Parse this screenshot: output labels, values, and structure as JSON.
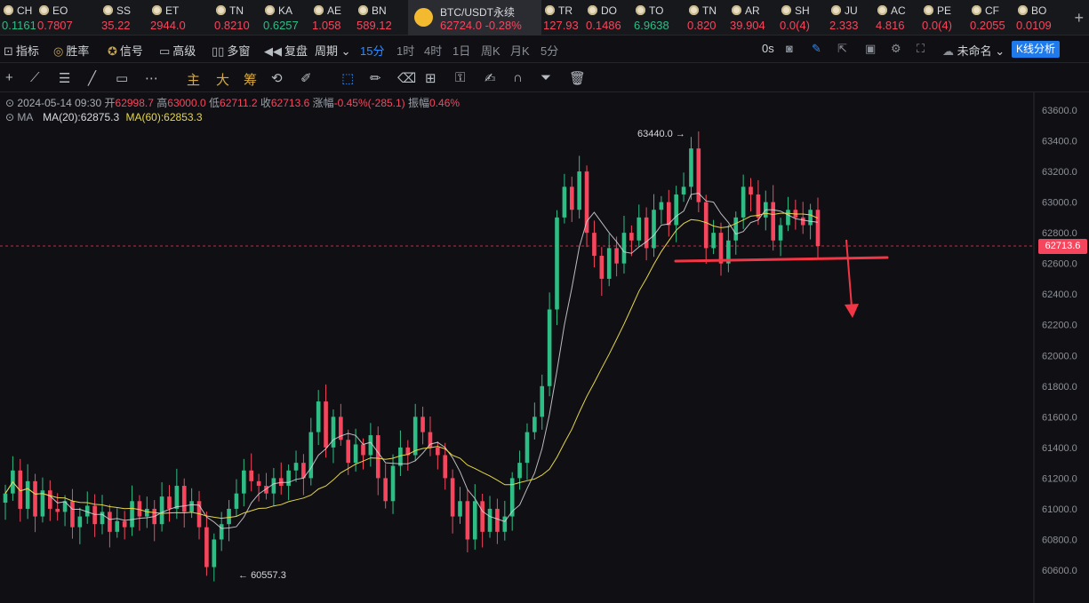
{
  "ticker": [
    {
      "sym": "CH",
      "val": "0.1161",
      "dir": "up"
    },
    {
      "sym": "EO",
      "val": "0.7807",
      "dir": "down"
    },
    {
      "sym": "SS",
      "val": "35.22",
      "dir": "down"
    },
    {
      "sym": "ET",
      "val": "2944.0",
      "dir": "down"
    },
    {
      "sym": "TN",
      "val": "0.8210",
      "dir": "down"
    },
    {
      "sym": "KA",
      "val": "0.6257",
      "dir": "up"
    },
    {
      "sym": "AE",
      "val": "1.058",
      "dir": "down"
    },
    {
      "sym": "BN",
      "val": "589.12",
      "dir": "down"
    },
    {
      "sym": "BTC/USDT永续",
      "val": "62724.0 -0.28%",
      "dir": "down",
      "active": true
    },
    {
      "sym": "TR",
      "val": "127.93",
      "dir": "down"
    },
    {
      "sym": "DO",
      "val": "0.1486",
      "dir": "down"
    },
    {
      "sym": "TO",
      "val": "6.9638",
      "dir": "up"
    },
    {
      "sym": "TN",
      "val": "0.820",
      "dir": "down"
    },
    {
      "sym": "AR",
      "val": "39.904",
      "dir": "down"
    },
    {
      "sym": "SH",
      "val": "0.0(4)",
      "dir": "down"
    },
    {
      "sym": "JU",
      "val": "2.333",
      "dir": "down"
    },
    {
      "sym": "AC",
      "val": "4.816",
      "dir": "down"
    },
    {
      "sym": "PE",
      "val": "0.0(4)",
      "dir": "down"
    },
    {
      "sym": "CF",
      "val": "0.2055",
      "dir": "down"
    },
    {
      "sym": "BO",
      "val": "0.0109",
      "dir": "down"
    }
  ],
  "toolbar": {
    "indicator": "指标",
    "win_rate": "胜率",
    "signal": "信号",
    "advanced": "高级",
    "multi_window": "多窗",
    "replay": "复盘",
    "period": "周期",
    "periods": [
      "15分",
      "1时",
      "4时",
      "1日",
      "周K",
      "月K",
      "5分"
    ],
    "timer": "0s",
    "layout_name": "未命名",
    "k_analysis": "K线分析"
  },
  "drawing_tools": {
    "main": "主",
    "big": "大",
    "chip": "筹"
  },
  "ohlc": {
    "date": "2024-05-14 09:30",
    "open_label": "开",
    "open": "62998.7",
    "high_label": "高",
    "high": "63000.0",
    "low_label": "低",
    "low": "62711.2",
    "close_label": "收",
    "close": "62713.6",
    "change_label": "涨幅",
    "change": "-0.45%(-285.1)",
    "amp_label": "振幅",
    "amp": "0.46%"
  },
  "ma": {
    "label": "MA",
    "ma20": "MA(20):62875.3",
    "ma60": "MA(60):62853.3"
  },
  "colors": {
    "up": "#2ebd85",
    "down": "#f6465d",
    "ma20": "#d9dbde",
    "ma60": "#e5d64a",
    "accent": "#2f8cff",
    "annotation": "#f23645"
  },
  "chart_data": {
    "type": "candlestick",
    "y_ticks": [
      63600,
      63400,
      63200,
      63000,
      62800,
      62600,
      62400,
      62200,
      62000,
      61800,
      61600,
      61400,
      61200,
      61000,
      60800,
      60600
    ],
    "ylim": [
      60500,
      63700
    ],
    "current_price": "62713.6",
    "high_annotation": "63440.0",
    "low_annotation": "60557.3",
    "close_series": [
      61100,
      61250,
      61000,
      61180,
      60950,
      61120,
      61000,
      60980,
      61050,
      60880,
      60950,
      61020,
      60900,
      60980,
      60850,
      60920,
      60880,
      61050,
      60950,
      61000,
      60900,
      61080,
      61000,
      61150,
      60980,
      61050,
      60880,
      60620,
      60800,
      60900,
      61000,
      61100,
      61250,
      61180,
      61150,
      61100,
      61200,
      61150,
      61250,
      61300,
      61200,
      61500,
      61700,
      61400,
      61600,
      61450,
      61300,
      61420,
      61350,
      61480,
      61200,
      61050,
      61280,
      61400,
      61350,
      61600,
      61500,
      61400,
      61350,
      61200,
      60950,
      61050,
      60800,
      61050,
      60850,
      61000,
      60850,
      60950,
      61200,
      61300,
      61500,
      61600,
      61800,
      62300,
      62900,
      63100,
      62950,
      63200,
      62800,
      62650,
      62500,
      62700,
      62600,
      62800,
      62750,
      62900,
      62700,
      62950,
      63000,
      62850,
      63050,
      63100,
      63350,
      63000,
      62700,
      62800,
      62600,
      62750,
      62900,
      63100,
      63050,
      62900,
      63000,
      62750,
      62850,
      62950,
      62900,
      62850,
      62950,
      62713.6
    ]
  }
}
